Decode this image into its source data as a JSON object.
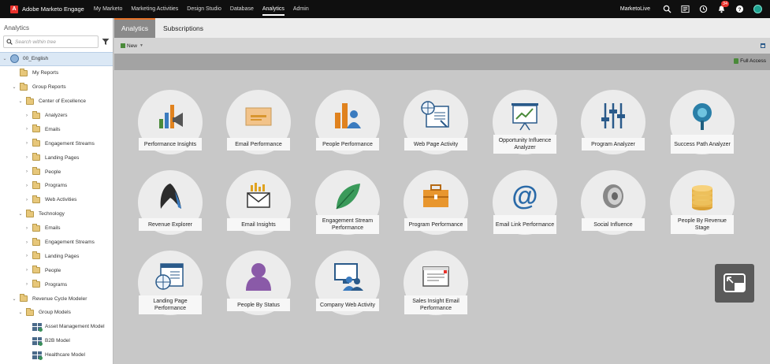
{
  "topbar": {
    "brand": "Adobe Marketo Engage",
    "logo_letter": "A",
    "nav": [
      "My Marketo",
      "Marketing Activities",
      "Design Studio",
      "Database",
      "Analytics",
      "Admin"
    ],
    "active_nav": "Analytics",
    "workspace": "MarketoLive",
    "notification_count": "34",
    "icons": [
      "search-icon",
      "list-icon",
      "history-icon",
      "bell-icon",
      "help-icon",
      "avatar"
    ]
  },
  "sidebar": {
    "title": "Analytics",
    "search_placeholder": "Search within tree",
    "tree": [
      {
        "label": "00_English",
        "toggle": "v",
        "icon": "globe",
        "selected": true
      },
      {
        "label": "My Reports",
        "toggle": "",
        "icon": "folder"
      },
      {
        "label": "Group Reports",
        "toggle": "v",
        "icon": "folder"
      },
      {
        "label": "Center of Excellence",
        "toggle": "v",
        "icon": "folder"
      },
      {
        "label": "Analyzers",
        "toggle": ">",
        "icon": "folder"
      },
      {
        "label": "Emails",
        "toggle": ">",
        "icon": "folder"
      },
      {
        "label": "Engagement Streams",
        "toggle": ">",
        "icon": "folder"
      },
      {
        "label": "Landing Pages",
        "toggle": ">",
        "icon": "folder"
      },
      {
        "label": "People",
        "toggle": ">",
        "icon": "folder"
      },
      {
        "label": "Programs",
        "toggle": ">",
        "icon": "folder"
      },
      {
        "label": "Web Activities",
        "toggle": ">",
        "icon": "folder"
      },
      {
        "label": "Technology",
        "toggle": "v",
        "icon": "folder"
      },
      {
        "label": "Emails",
        "toggle": ">",
        "icon": "folder"
      },
      {
        "label": "Engagement Streams",
        "toggle": ">",
        "icon": "folder"
      },
      {
        "label": "Landing Pages",
        "toggle": ">",
        "icon": "folder"
      },
      {
        "label": "People",
        "toggle": ">",
        "icon": "folder"
      },
      {
        "label": "Programs",
        "toggle": ">",
        "icon": "folder"
      },
      {
        "label": "Revenue Cycle Modeler",
        "toggle": "v",
        "icon": "folder"
      },
      {
        "label": "Group Models",
        "toggle": "v",
        "icon": "folder"
      },
      {
        "label": "Asset Management Model",
        "toggle": "",
        "icon": "model"
      },
      {
        "label": "B2B Model",
        "toggle": "",
        "icon": "model"
      },
      {
        "label": "Healthcare Model",
        "toggle": "",
        "icon": "model"
      }
    ]
  },
  "tabs": [
    "Analytics",
    "Subscriptions"
  ],
  "toolbar": {
    "new_label": "New",
    "access_label": "Full Access"
  },
  "tiles": [
    {
      "label": "Performance Insights",
      "icon": "bar-chart-megaphone-icon"
    },
    {
      "label": "Email Performance",
      "icon": "envelope-icon"
    },
    {
      "label": "People Performance",
      "icon": "people-bars-icon"
    },
    {
      "label": "Web Page Activity",
      "icon": "web-page-globe-icon"
    },
    {
      "label": "Opportunity Influence Analyzer",
      "icon": "presentation-chart-icon"
    },
    {
      "label": "Program Analyzer",
      "icon": "sliders-icon"
    },
    {
      "label": "Success Path Analyzer",
      "icon": "map-pin-icon"
    },
    {
      "label": "Revenue Explorer",
      "icon": "revenue-explorer-icon"
    },
    {
      "label": "Email Insights",
      "icon": "email-insights-icon"
    },
    {
      "label": "Engagement Stream Performance",
      "icon": "leaf-icon"
    },
    {
      "label": "Program Performance",
      "icon": "briefcase-icon"
    },
    {
      "label": "Email Link Performance",
      "icon": "at-sign-icon"
    },
    {
      "label": "Social Influence",
      "icon": "speaker-icon"
    },
    {
      "label": "People By Revenue Stage",
      "icon": "coins-icon"
    },
    {
      "label": "Landing Page Performance",
      "icon": "landing-page-globe-icon"
    },
    {
      "label": "People By Status",
      "icon": "person-icon"
    },
    {
      "label": "Company Web Activity",
      "icon": "company-web-icon"
    },
    {
      "label": "Sales Insight Email Performance",
      "icon": "sales-email-icon"
    }
  ]
}
